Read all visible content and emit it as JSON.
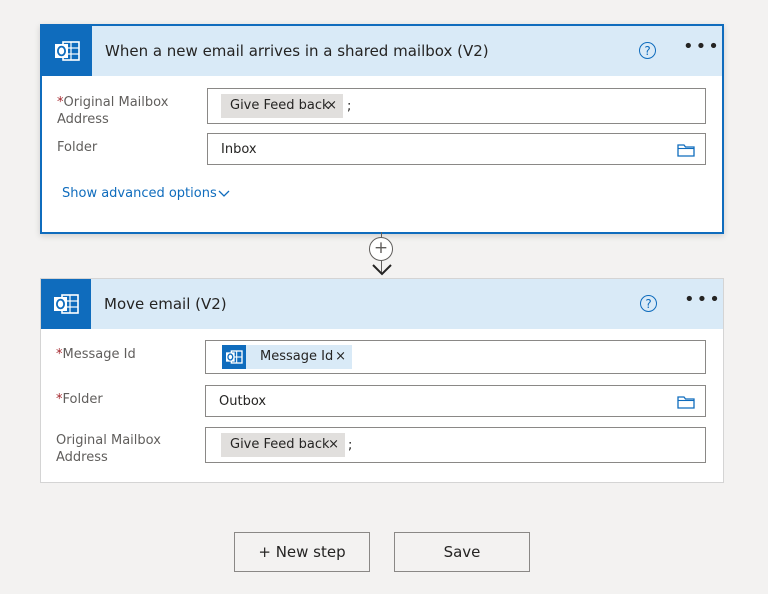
{
  "trigger": {
    "title": "When a new email arrives in a shared mailbox (V2)",
    "help_glyph": "?",
    "more_glyph": "•••",
    "fields": {
      "mailbox_label": "Original Mailbox Address",
      "mailbox_required": "*",
      "mailbox_token": "Give Feed back",
      "mailbox_separator": ";",
      "folder_label": "Folder",
      "folder_value": "Inbox"
    },
    "advanced_label": "Show advanced options"
  },
  "connector": {
    "plus_glyph": "+"
  },
  "action": {
    "title": "Move email (V2)",
    "help_glyph": "?",
    "more_glyph": "•••",
    "fields": {
      "message_label": "Message Id",
      "message_required": "*",
      "message_token": "Message Id",
      "folder_label": "Folder",
      "folder_required": "*",
      "folder_value": "Outbox",
      "mailbox_label": "Original Mailbox Address",
      "mailbox_token": "Give Feed back",
      "mailbox_separator": ";"
    }
  },
  "token_remove_glyph": "×",
  "buttons": {
    "new_step": "+ New step",
    "save": "Save"
  },
  "icons": {
    "app": "outlook-icon",
    "help": "help-circle-icon",
    "more": "more-options-icon",
    "folder": "folder-picker-icon",
    "chevron": "chevron-down-icon",
    "add": "add-step-icon",
    "arrow": "arrow-down-icon"
  },
  "colors": {
    "accent": "#0f6cbd",
    "header_bg": "#d9eaf7",
    "required": "#a4262c"
  }
}
